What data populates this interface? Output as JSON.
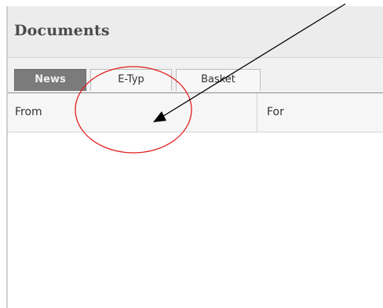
{
  "header": {
    "title": "Documents"
  },
  "tabs": [
    {
      "label": "News",
      "active": true
    },
    {
      "label": "E-Typ",
      "active": false
    },
    {
      "label": "Basket",
      "active": false
    }
  ],
  "table": {
    "columns": [
      "From",
      "For"
    ],
    "rows": []
  },
  "annotation": {
    "circle_color": "#e11b1b",
    "arrow_color": "#000000"
  }
}
